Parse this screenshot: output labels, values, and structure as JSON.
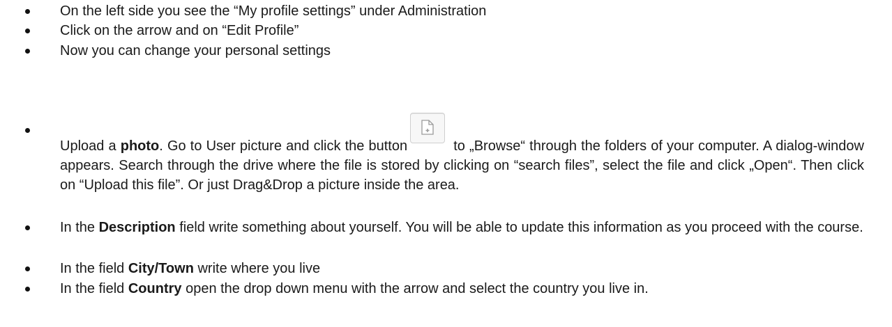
{
  "bullets": {
    "b1": "On the left side you see the “My profile settings” under Administration",
    "b2": "Click on the arrow and on “Edit Profile”",
    "b3": "Now you can change your personal settings",
    "b4_pre": "Upload a ",
    "b4_bold": "photo",
    "b4_mid": ". Go to User picture and click the button",
    "b4_post": " to „Browse“ through the folders of your computer. A dialog-window appears. Search through the drive where the file is stored by clicking on “search files”, select the file and click „Open“. Then click on “Upload this file”. Or just Drag&Drop a picture inside the area.",
    "b5_pre": "In the ",
    "b5_bold": "Description",
    "b5_post": " field write something about yourself. You will be able to update this information as you proceed with the course.",
    "b6_pre": "In the field ",
    "b6_bold": "City/Town",
    "b6_post": " write where you live",
    "b7_pre": "In the field ",
    "b7_bold": "Country",
    "b7_post": " open the drop down menu with the arrow and select the country you live in."
  },
  "icons": {
    "file_button": "file-add-icon"
  }
}
